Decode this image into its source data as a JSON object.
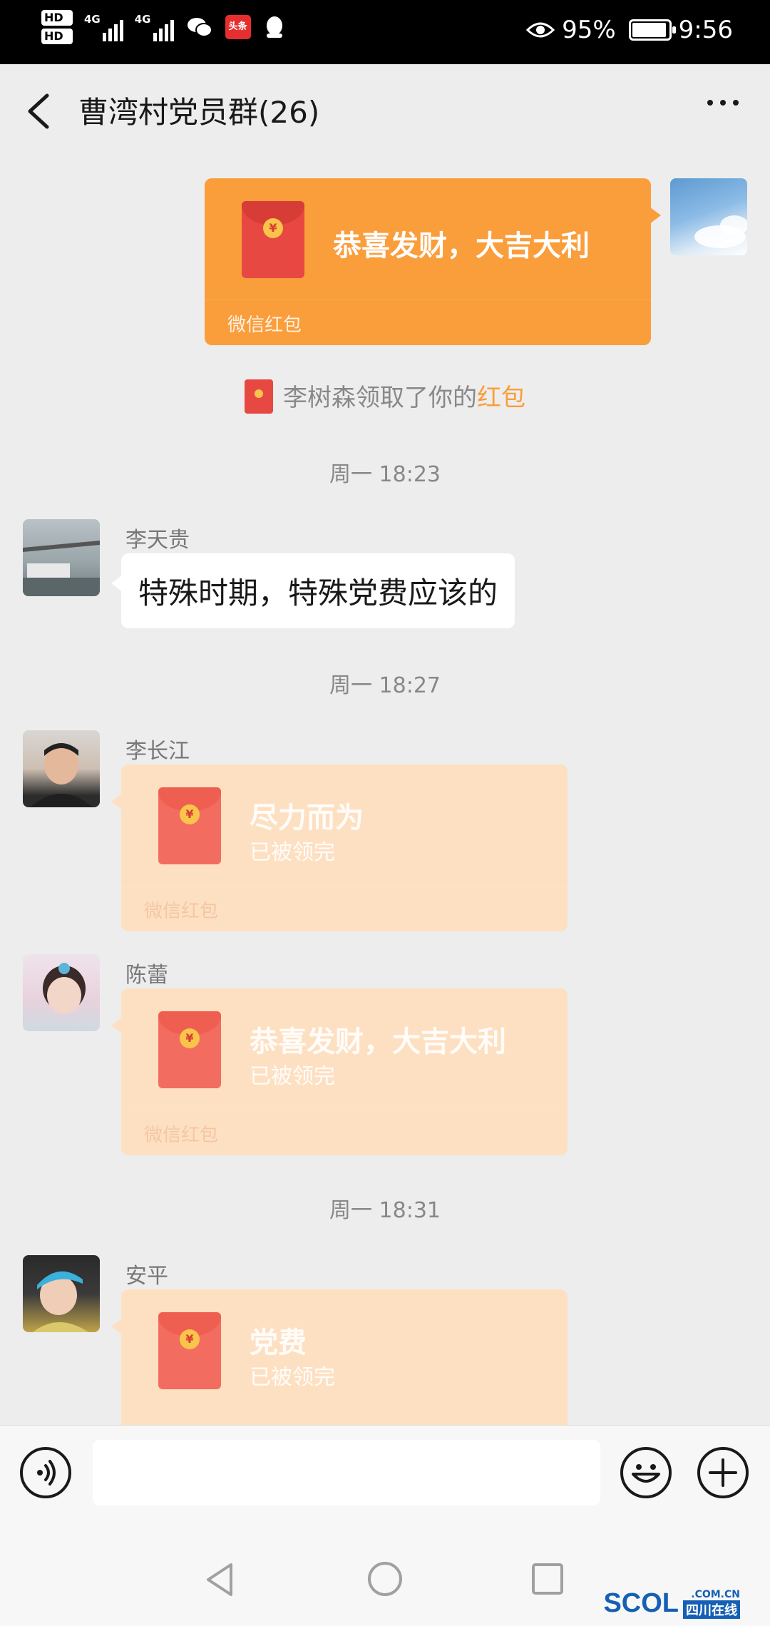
{
  "status_bar": {
    "hd1": "HD",
    "hd2": "HD",
    "net1": "4G",
    "net2": "4G",
    "toutiao": "头条",
    "battery_percent": "95%",
    "battery_level": 0.95,
    "time": "9:56"
  },
  "header": {
    "title": "曹湾村党员群(26)"
  },
  "messages": {
    "sent_packet": {
      "title": "恭喜发财，大吉大利",
      "footer": "微信红包"
    },
    "notice": {
      "text": "李树森领取了你的",
      "highlight": "红包"
    },
    "time1": "周一 18:23",
    "msg1": {
      "name": "李天贵",
      "text": "特殊时期，特殊党费应该的"
    },
    "time2": "周一 18:27",
    "msg2": {
      "name": "李长江",
      "title": "尽力而为",
      "status": "已被领完",
      "footer": "微信红包"
    },
    "msg3": {
      "name": "陈蕾",
      "title": "恭喜发财，大吉大利",
      "status": "已被领完",
      "footer": "微信红包"
    },
    "time3": "周一 18:31",
    "msg4": {
      "name": "安平",
      "title": "党费",
      "status": "已被领完"
    }
  },
  "watermark": {
    "logo": "SCOL",
    "domain": ".COM.CN",
    "cn": "四川在线"
  },
  "icons": {
    "back": "chevron-left",
    "more": "ellipsis",
    "voice": "voice-icon",
    "emoji": "smile-icon",
    "plus": "plus-icon"
  },
  "colors": {
    "red_packet_sent": "#fa9d3b",
    "red_packet_opened": "#fde0c2",
    "envelope": "#e84842",
    "highlight": "#fa9d3b"
  }
}
